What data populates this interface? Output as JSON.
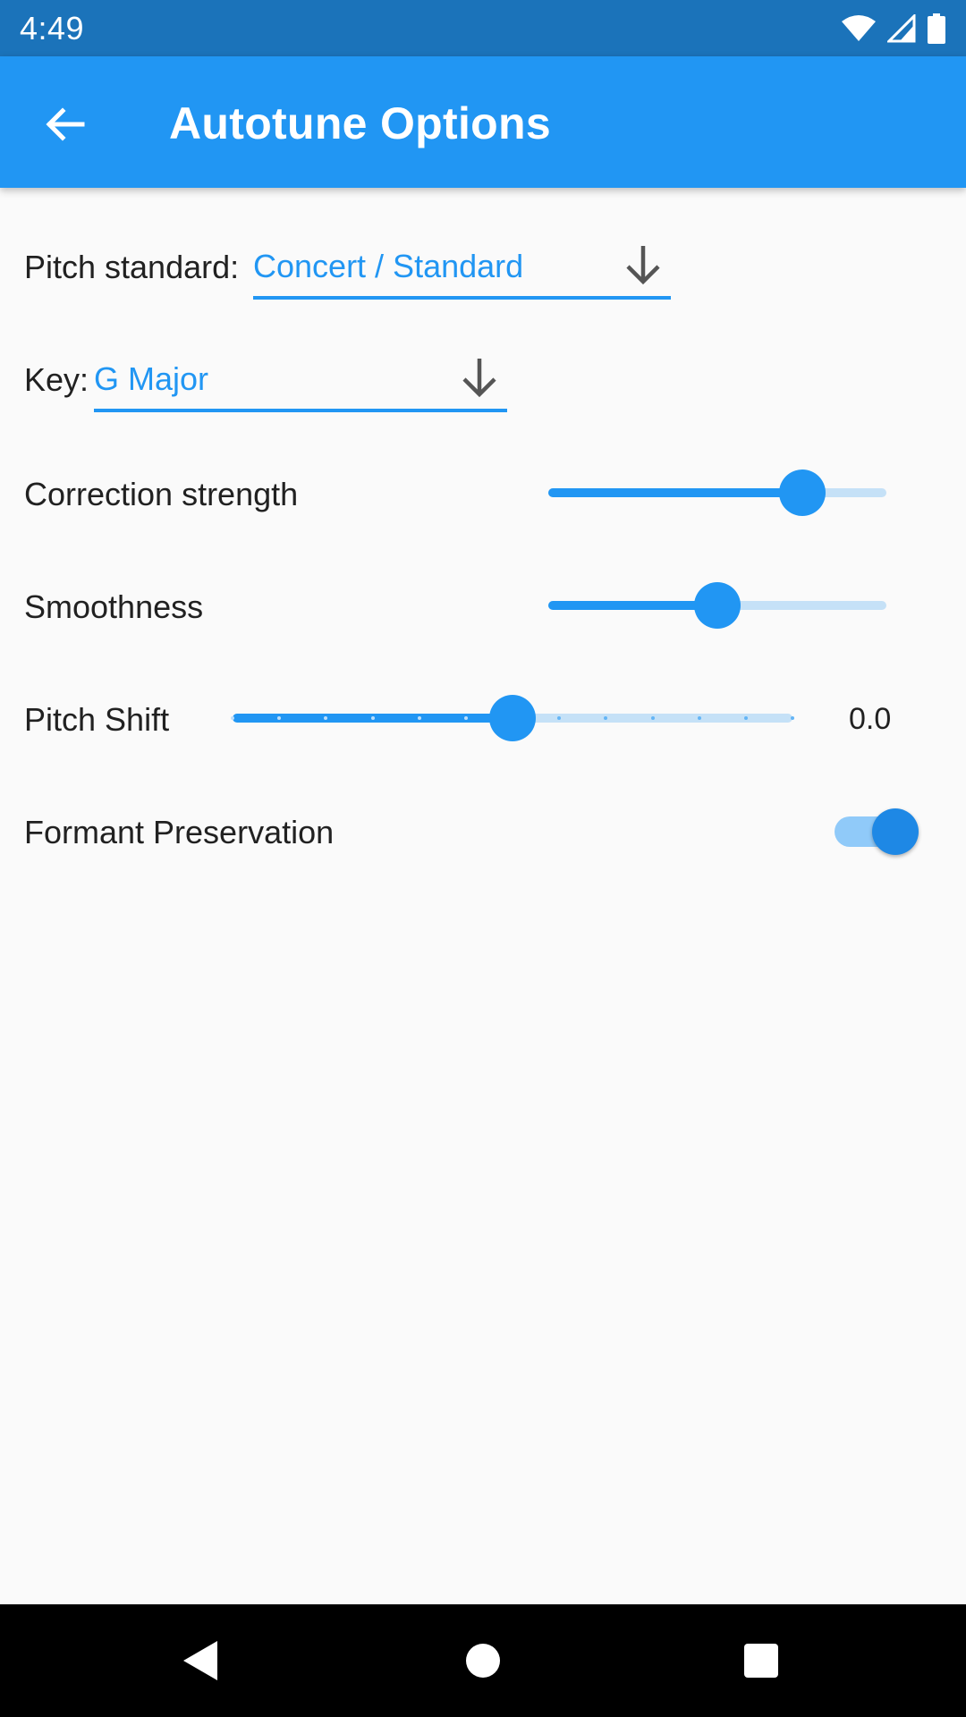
{
  "status_bar": {
    "time": "4:49",
    "icons": [
      "wifi-icon",
      "signal-icon",
      "battery-icon"
    ]
  },
  "app_bar": {
    "title": "Autotune Options",
    "back_icon": "arrow-back-icon"
  },
  "settings": {
    "pitch_standard": {
      "label": "Pitch standard:",
      "value": "Concert / Standard"
    },
    "key": {
      "label": "Key:",
      "value": "G Major"
    },
    "correction_strength": {
      "label": "Correction strength",
      "fraction": 0.75
    },
    "smoothness": {
      "label": "Smoothness",
      "fraction": 0.5
    },
    "pitch_shift": {
      "label": "Pitch Shift",
      "value_text": "0.0",
      "fraction": 0.5,
      "divisions": 12
    },
    "formant_preservation": {
      "label": "Formant Preservation",
      "enabled": true
    }
  },
  "nav_bar": {
    "buttons": [
      "back-triangle-icon",
      "home-circle-icon",
      "recents-square-icon"
    ]
  },
  "colors": {
    "primary": "#2196f3",
    "status_bar": "#1b73ba",
    "track_inactive": "#c5e1f7",
    "text": "#212121"
  }
}
